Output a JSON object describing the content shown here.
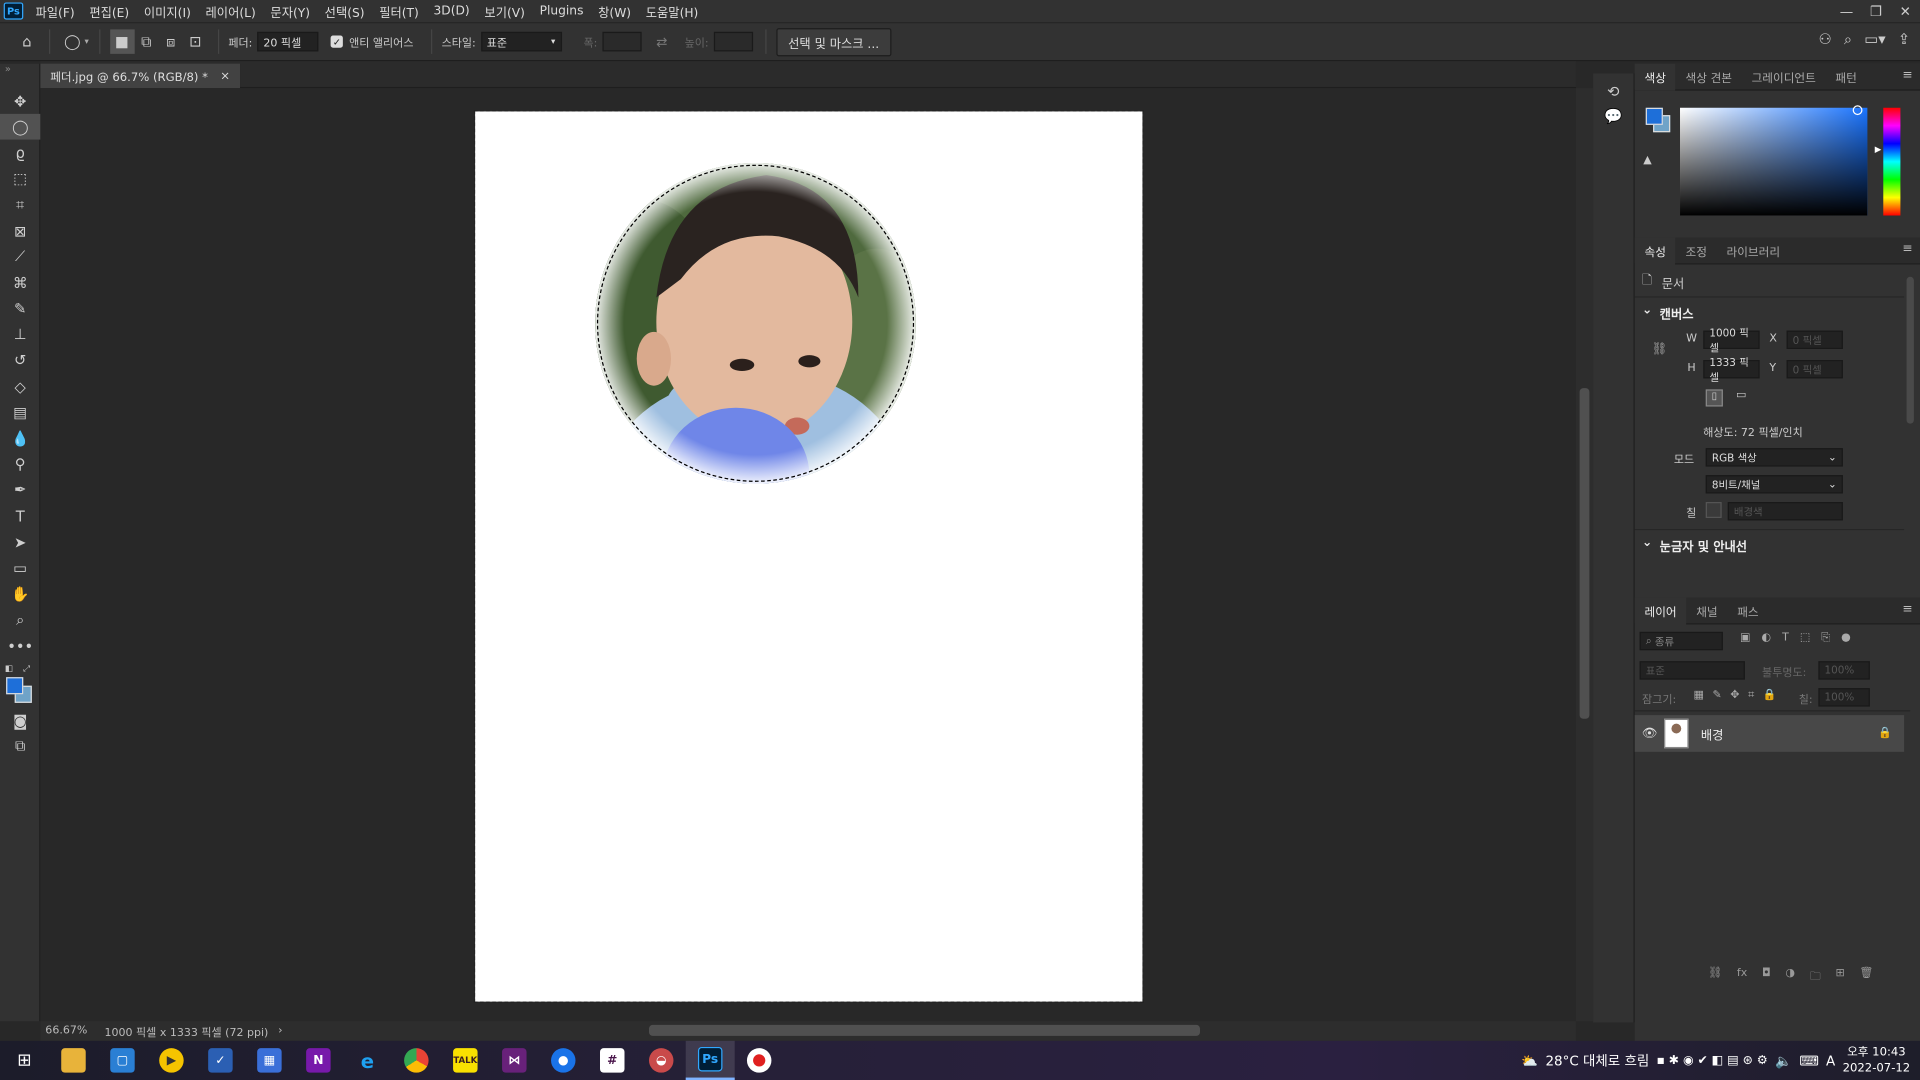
{
  "menubar": {
    "items": [
      "파일(F)",
      "편집(E)",
      "이미지(I)",
      "레이어(L)",
      "문자(Y)",
      "선택(S)",
      "필터(T)",
      "3D(D)",
      "보기(V)",
      "Plugins",
      "창(W)",
      "도움말(H)"
    ]
  },
  "options": {
    "feather_label": "페더:",
    "feather_value": "20 픽셀",
    "antialias_label": "앤티 앨리어스",
    "style_label": "스타일:",
    "style_value": "표준",
    "width_label": "폭:",
    "height_label": "높이:",
    "select_mask_label": "선택 및 마스크 ..."
  },
  "document": {
    "tab_title": "페더.jpg @ 66.7% (RGB/8) *",
    "close": "×"
  },
  "status": {
    "zoom": "66.67%",
    "info": "1000 픽셀 x 1333 픽셀 (72 ppi)",
    "arrow": "›"
  },
  "color_panel": {
    "tabs": [
      "색상",
      "색상 견본",
      "그레이디언트",
      "패턴"
    ],
    "fg": "#1e6fd9",
    "bg": "#6fa3c8"
  },
  "properties": {
    "tabs": [
      "속성",
      "조정",
      "라이브러리"
    ],
    "doc_label": "문서",
    "canvas_title": "캔버스",
    "w_label": "W",
    "w_value": "1000 픽셀",
    "h_label": "H",
    "h_value": "1333 픽셀",
    "x_label": "X",
    "x_value": "0 픽셀",
    "y_label": "Y",
    "y_value": "0 픽셀",
    "resolution": "해상도: 72 픽셀/인치",
    "mode_label": "모드",
    "mode_value": "RGB 색상",
    "depth_value": "8비트/채널",
    "fill_label": "칠",
    "fill_value": "배경색",
    "rulers_title": "눈금자 및 안내선"
  },
  "layers": {
    "tabs": [
      "레이어",
      "채널",
      "패스"
    ],
    "filter_placeholder": "종류",
    "blend_value": "표준",
    "opacity_label": "불투명도:",
    "opacity_value": "100%",
    "lock_label": "잠그기:",
    "fill_label": "칠:",
    "fill_value": "100%",
    "layer_name": "배경"
  },
  "taskbar": {
    "weather": "28°C  대체로 흐림",
    "time": "오후 10:43",
    "date": "2022-07-12",
    "lang": "A"
  }
}
